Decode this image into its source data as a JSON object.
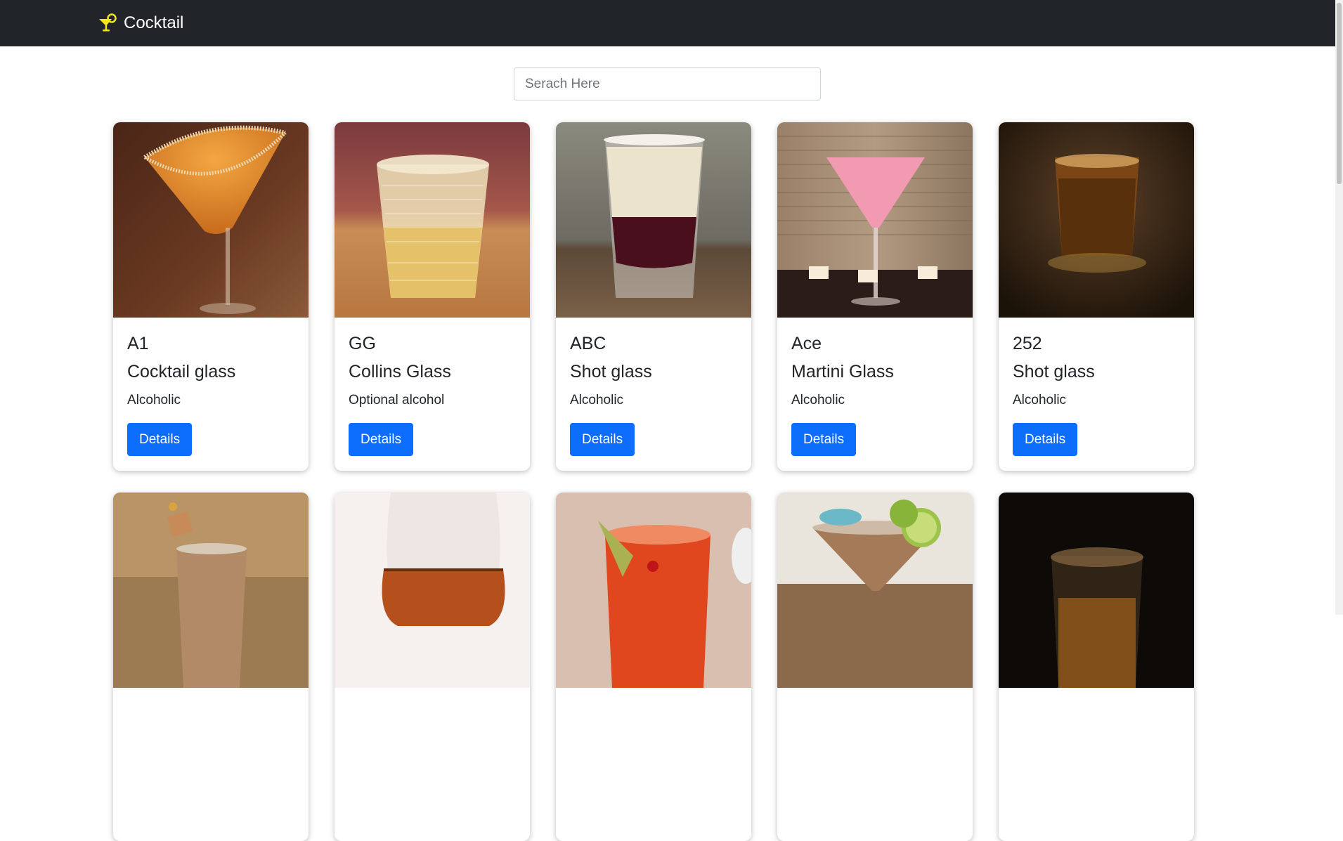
{
  "navbar": {
    "brand": "Cocktail",
    "logo_icon": "cocktail-glass-icon",
    "logo_color": "#f5e71b"
  },
  "search": {
    "placeholder": "Serach Here"
  },
  "button_color": "#0d6efd",
  "cards": [
    {
      "name": "A1",
      "glass": "Cocktail glass",
      "type": "Alcoholic",
      "button": "Details"
    },
    {
      "name": "GG",
      "glass": "Collins Glass",
      "type": "Optional alcohol",
      "button": "Details"
    },
    {
      "name": "ABC",
      "glass": "Shot glass",
      "type": "Alcoholic",
      "button": "Details"
    },
    {
      "name": "Ace",
      "glass": "Martini Glass",
      "type": "Alcoholic",
      "button": "Details"
    },
    {
      "name": "252",
      "glass": "Shot glass",
      "type": "Alcoholic",
      "button": "Details"
    }
  ],
  "row2_images": [
    "layered-shot-photo",
    "wine-glass-photo",
    "red-cocktail-photo",
    "martini-lime-photo",
    "whiskey-glass-photo"
  ]
}
